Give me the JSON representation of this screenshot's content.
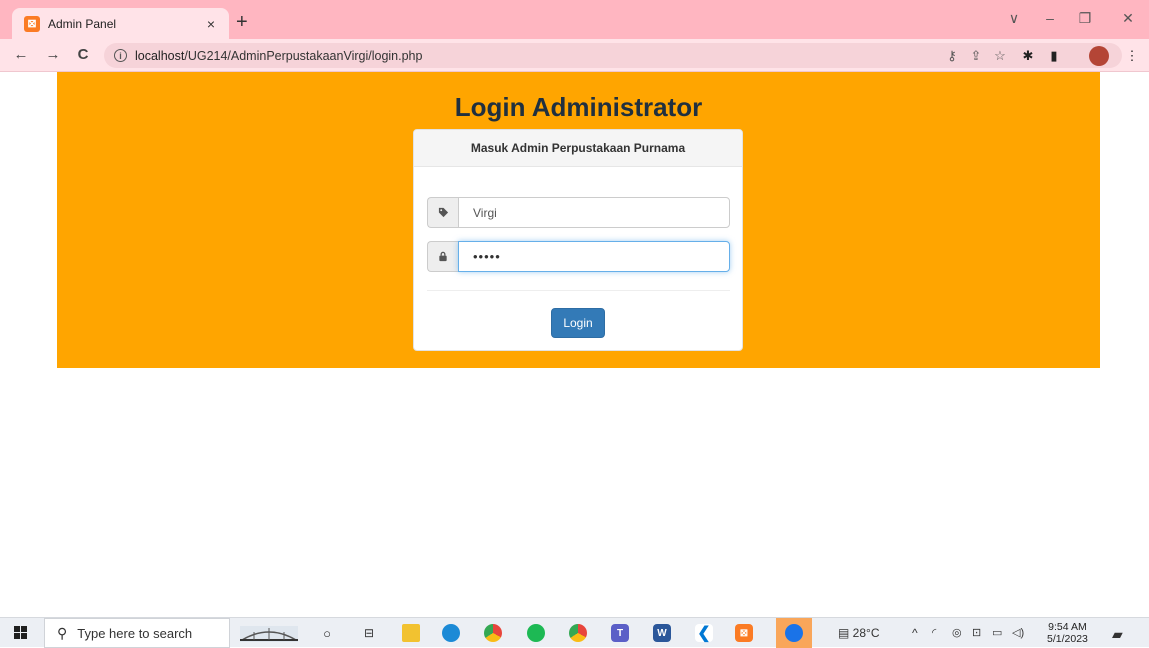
{
  "browser": {
    "tab_title": "Admin Panel",
    "tab_close": "×",
    "new_tab": "+",
    "favicon": "xampp-icon",
    "url_host": "localhost",
    "url_path": "/UG214/AdminPerpustakaanVirgi/login.php",
    "nav_back": "←",
    "nav_forward": "→",
    "nav_reload": "C",
    "window_controls": {
      "collapse": "∨",
      "minimize": "–",
      "restore": "❐",
      "close": "✕"
    },
    "toolbar_icons": {
      "key": "⚷",
      "share": "⇪",
      "star": "☆",
      "extensions": "✱",
      "sidepanel": "▮",
      "menu": "⋮"
    }
  },
  "page": {
    "title": "Login Administrator",
    "panel_heading": "Masuk Admin Perpustakaan Purnama",
    "username_value": "Virgi",
    "password_mask": "•••••",
    "login_label": "Login",
    "colors": {
      "banner": "#ffa500",
      "button": "#337ab7",
      "title": "#20303f"
    }
  },
  "taskbar": {
    "search_placeholder": "Type here to search",
    "weather": "28°C",
    "time": "9:54 AM",
    "date": "5/1/2023",
    "tray_chevron": "^"
  }
}
